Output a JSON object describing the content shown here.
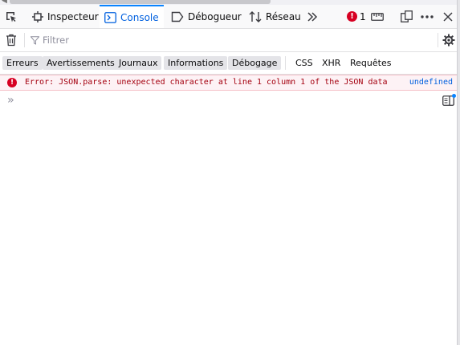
{
  "toolbar": {
    "tabs": [
      {
        "label": "Inspecteur",
        "icon": "inspector-icon"
      },
      {
        "label": "Console",
        "icon": "console-icon",
        "selected": true
      },
      {
        "label": "Débogueur",
        "icon": "debugger-icon"
      },
      {
        "label": "Réseau",
        "icon": "network-icon"
      }
    ],
    "error_count": "1",
    "error_badge": "!",
    "accent_color": "#0a84ff",
    "error_color": "#d70022"
  },
  "filterbar": {
    "placeholder": "Filtrer"
  },
  "levels": {
    "errors": "Erreurs",
    "warnings": "Avertissements",
    "logs": "Journaux",
    "info": "Informations",
    "debug": "Débogage",
    "css": "CSS",
    "xhr": "XHR",
    "requests": "Requêtes"
  },
  "messages": [
    {
      "level": "error",
      "icon": "!",
      "text": "Error: JSON.parse: unexpected character at line 1 column 1 of the JSON data",
      "source": "undefined"
    }
  ],
  "input": {
    "prompt": "»"
  }
}
